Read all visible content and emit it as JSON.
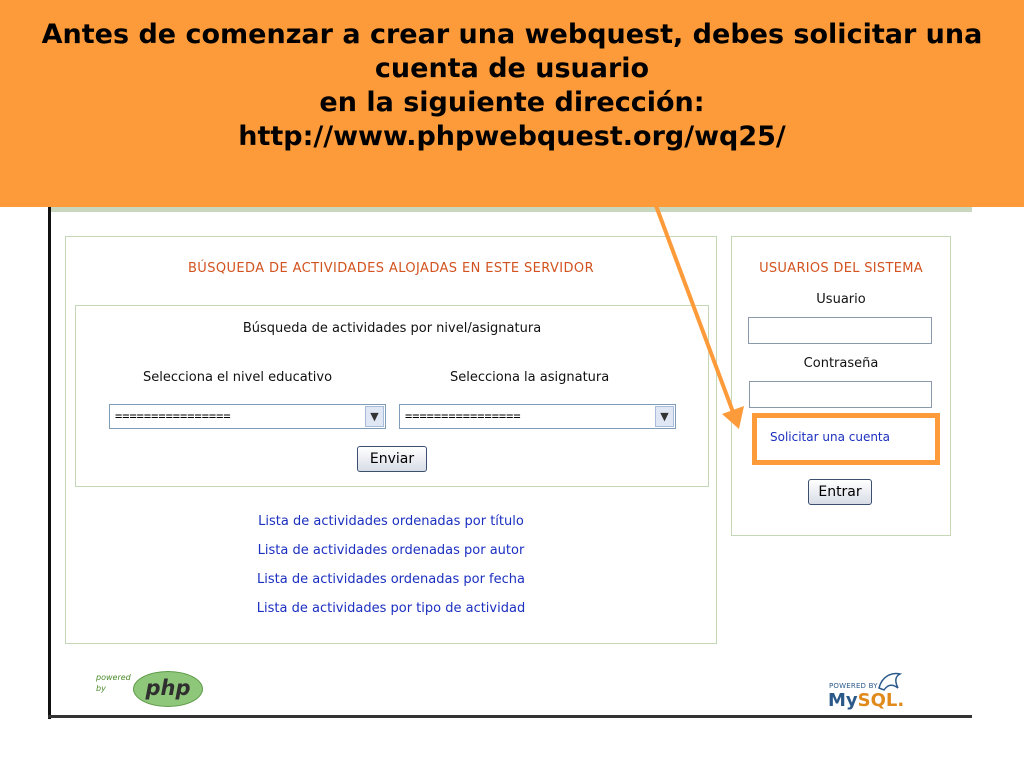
{
  "banner": {
    "line1": "Antes de comenzar a crear una webquest, debes solicitar una",
    "line2": "cuenta de usuario",
    "line3": "en la siguiente dirección:",
    "line4": "http://www.phpwebquest.org/wq25/"
  },
  "search": {
    "title": "BÚSQUEDA DE ACTIVIDADES ALOJADAS EN ESTE SERVIDOR",
    "subtitle": "Búsqueda de actividades por nivel/asignatura",
    "level_label": "Selecciona el nivel educativo",
    "subject_label": "Selecciona la asignatura",
    "level_value": "================",
    "subject_value": "================",
    "submit_label": "Enviar"
  },
  "links": [
    "Lista de actividades ordenadas por título",
    "Lista de actividades ordenadas por autor",
    "Lista de actividades ordenadas por fecha",
    "Lista de actividades por tipo de actividad"
  ],
  "users": {
    "title": "USUARIOS DEL SISTEMA",
    "username_label": "Usuario",
    "password_label": "Contraseña",
    "request_link": "Solicitar una cuenta",
    "login_label": "Entrar"
  },
  "logos": {
    "php_powered_1": "powered",
    "php_powered_2": "by",
    "php_text": "php",
    "mysql_powered": "POWERED BY",
    "mysql_my": "My",
    "mysql_sql": "SQL."
  },
  "colors": {
    "banner": "#fd9b3a",
    "section_title": "#d2531f",
    "link": "#1b2fc0",
    "panel_border": "#c4d8b8"
  },
  "icons": {
    "dropdown": "chevron-down-icon",
    "arrow": "callout-arrow"
  }
}
